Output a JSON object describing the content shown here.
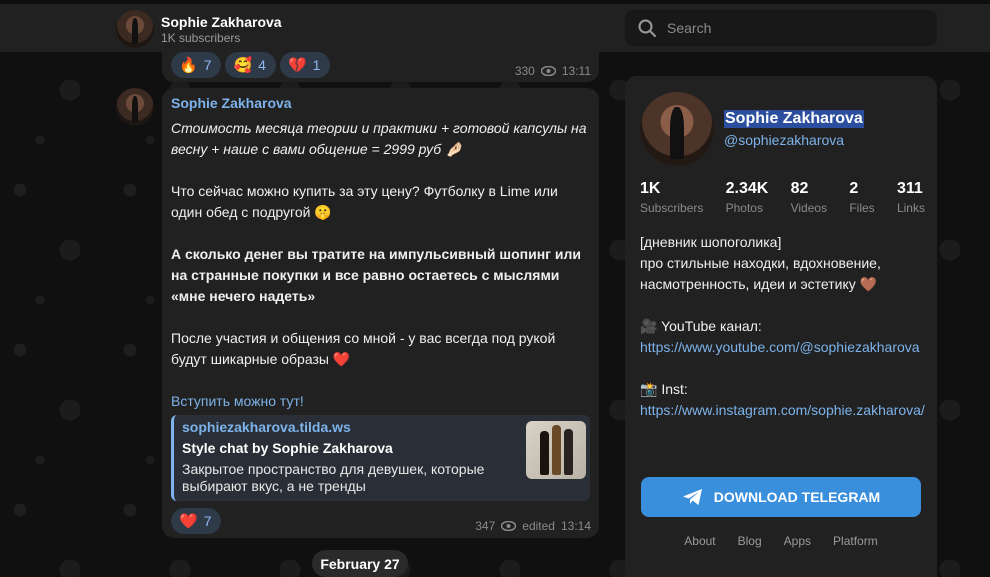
{
  "channel": {
    "title": "Sophie Zakharova",
    "subtitle": "1K subscribers"
  },
  "search": {
    "placeholder": "Search"
  },
  "prev_message": {
    "reactions": [
      {
        "emoji": "🔥",
        "count": "7"
      },
      {
        "emoji": "🥰",
        "count": "4"
      },
      {
        "emoji": "💔",
        "count": "1"
      }
    ],
    "views": "330",
    "time": "13:11"
  },
  "message": {
    "author": "Sophie Zakharova",
    "paragraphs": [
      "Стоимость месяца теории и практики + готовой капсулы на весну + наше с вами общение = 2999 руб 🤌🏻",
      "Что сейчас можно купить за эту цену? Футболку в Lime или один обед с подругой 🤫",
      "А сколько денег вы тратите на импульсивный шопинг или на странные покупки и все равно остаетесь с мыслями «мне нечего надеть»",
      "После участия и общения со мной - у вас всегда под рукой будут шикарные образы ❤️"
    ],
    "link_text": "Вступить можно тут!",
    "preview": {
      "site": "sophiezakharova.tilda.ws",
      "title": "Style chat by Sophie Zakharova",
      "description": "Закрытое пространство для девушек, которые выбирают вкус, а не тренды"
    },
    "reaction": {
      "emoji": "❤️",
      "count": "7"
    },
    "views": "347",
    "edited": "edited",
    "time": "13:14"
  },
  "date_separator": "February 27",
  "panel": {
    "name": "Sophie Zakharova",
    "handle": "@sophiezakharova",
    "stats": [
      {
        "num": "1K",
        "label": "Subscribers"
      },
      {
        "num": "2.34K",
        "label": "Photos"
      },
      {
        "num": "82",
        "label": "Videos"
      },
      {
        "num": "2",
        "label": "Files"
      },
      {
        "num": "311",
        "label": "Links"
      }
    ],
    "about_line1": "[дневник шопоголика]",
    "about_line2": "про стильные находки, вдохновение, насмотренность, идеи и эстетику 🤎",
    "youtube_label": "🎥 YouTube канал:",
    "youtube_url": "https://www.youtube.com/@sophiezakharova",
    "inst_label": "📸 Inst:",
    "inst_url": "https://www.instagram.com/sophie.zakharova/",
    "download_label": "DOWNLOAD TELEGRAM",
    "footer": [
      "About",
      "Blog",
      "Apps",
      "Platform"
    ]
  },
  "colors": {
    "accent": "#7db3ea",
    "button": "#3a8fdd",
    "surface": "#212121"
  }
}
